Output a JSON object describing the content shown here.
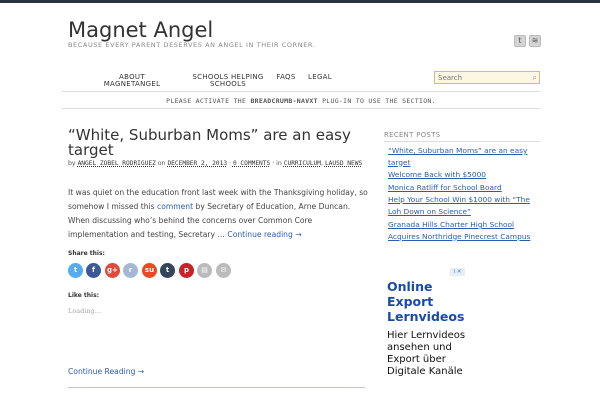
{
  "site": {
    "title": "Magnet Angel",
    "tagline": "Because every parent deserves an angel in their corner."
  },
  "social": [
    {
      "icon": "twitter-icon"
    },
    {
      "icon": "rss-icon"
    }
  ],
  "nav": {
    "items": [
      {
        "line1": "About",
        "line2": "MagnetAngel"
      },
      {
        "line1": "Schools Helping",
        "line2": "Schools"
      },
      {
        "line1": "FAQs",
        "line2": ""
      },
      {
        "line1": "Legal",
        "line2": ""
      }
    ],
    "search_placeholder": "Search"
  },
  "notice": {
    "before": "PLEASE ACTIVATE THE ",
    "plugin": "BREADCRUMB-NAVXT",
    "after": " PLUG-IN TO USE THE SECTION."
  },
  "post": {
    "title": "“White, Suburban Moms” are an easy target",
    "meta_by": "by ",
    "author": "Angel Zobel Rodriguez",
    "meta_on": " on ",
    "date": "December 2, 2013",
    "meta_sep": " · ",
    "comments": "0 Comments",
    "meta_in": " · in ",
    "category1": "Curriculum",
    "meta_comma": ", ",
    "category2": "LAUSD News",
    "excerpt_1": "It was quiet on the education front last week with the Thanksgiving holiday, so somehow I missed this ",
    "excerpt_link": "comment",
    "excerpt_2": " by Secretary of Education, Arne Duncan. When discussing who’s behind the concerns over Common Core implementation and testing, Secretary … ",
    "continue_inline": "Continue reading →",
    "share_label": "Share this:",
    "like_label": "Like this:",
    "loading": "Loading...",
    "continue_reading": "Continue Reading →"
  },
  "share_buttons": [
    {
      "name": "twitter",
      "glyph": "t",
      "color": "#55acee"
    },
    {
      "name": "facebook",
      "glyph": "f",
      "color": "#3b5998"
    },
    {
      "name": "google-plus",
      "glyph": "g+",
      "color": "#dd4b39"
    },
    {
      "name": "reddit",
      "glyph": "r",
      "color": "#a4b8d6"
    },
    {
      "name": "stumbleupon",
      "glyph": "su",
      "color": "#eb4924"
    },
    {
      "name": "tumblr",
      "glyph": "t",
      "color": "#35465c"
    },
    {
      "name": "pinterest",
      "glyph": "p",
      "color": "#cb2027"
    },
    {
      "name": "print",
      "glyph": "▤",
      "color": "#bbbbbb"
    },
    {
      "name": "email",
      "glyph": "✉",
      "color": "#bbbbbb"
    }
  ],
  "sidebar": {
    "heading": "Recent Posts",
    "recent_posts": [
      "“White, Suburban Moms” are an easy target",
      "Welcome Back with $5000",
      "Monica Ratliff for School Board",
      "Help Your School Win $1000 with “The Loh Down on Science”",
      "Granada Hills Charter High School Acquires Northridge Pinecrest Campus"
    ]
  },
  "ad": {
    "badge": "i ✕",
    "headline": "Online Export Lernvideos",
    "body": "Hier Lernvideos ansehen und Export über Digitale Kanäle"
  },
  "colors": {
    "link": "#2a5db0",
    "topbar": "#2b3140",
    "search_bg": "#fcf7e2",
    "ad_headline": "#1a4aa8"
  }
}
